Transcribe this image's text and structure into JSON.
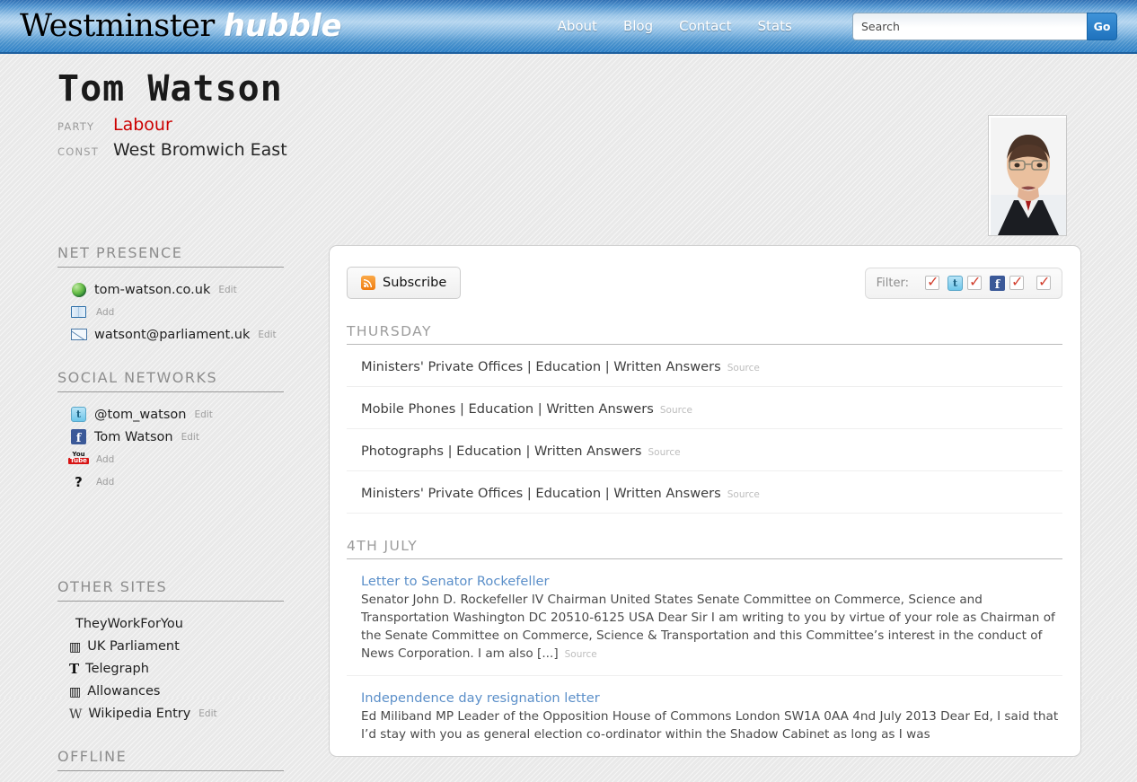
{
  "header": {
    "logo_primary": "Westminster",
    "logo_secondary": "hubble",
    "nav": [
      {
        "label": "About"
      },
      {
        "label": "Blog"
      },
      {
        "label": "Contact"
      },
      {
        "label": "Stats"
      }
    ],
    "search": {
      "placeholder": "Search",
      "value": "",
      "button_label": "Go"
    },
    "colors": {
      "accent": "#2f82c8",
      "light": "#b4d5ef"
    }
  },
  "person": {
    "name": "Tom Watson",
    "party_label": "PARTY",
    "party_value": "Labour",
    "party_color": "#cc0000",
    "const_label": "CONST",
    "const_value": "West Bromwich East",
    "photo_alt": "Tom Watson portrait"
  },
  "sidebar": {
    "sections": [
      {
        "title": "NET PRESENCE",
        "items": [
          {
            "icon": "globe-icon",
            "label": "tom-watson.co.uk",
            "action": "Edit"
          },
          {
            "icon": "book-icon",
            "label": "",
            "action": "Add"
          },
          {
            "icon": "mail-icon",
            "label": "watsont@parliament.uk",
            "action": "Edit"
          }
        ]
      },
      {
        "title": "SOCIAL NETWORKS",
        "items": [
          {
            "icon": "twitter-icon",
            "label": "@tom_watson",
            "action": "Edit"
          },
          {
            "icon": "facebook-icon",
            "label": "Tom Watson",
            "action": "Edit"
          },
          {
            "icon": "youtube-icon",
            "label": "",
            "action": "Add"
          },
          {
            "icon": "unknown-icon",
            "label": "",
            "action": "Add"
          }
        ]
      },
      {
        "title": "OTHER SITES",
        "items": [
          {
            "icon": "theyworkforyou-icon",
            "label": "TheyWorkForYou",
            "action": ""
          },
          {
            "icon": "portcullis-icon",
            "label": "UK Parliament",
            "action": ""
          },
          {
            "icon": "telegraph-icon",
            "label": "Telegraph",
            "action": ""
          },
          {
            "icon": "portcullis-icon",
            "label": "Allowances",
            "action": ""
          },
          {
            "icon": "wikipedia-icon",
            "label": "Wikipedia Entry",
            "action": "Edit"
          }
        ]
      },
      {
        "title": "OFFLINE",
        "items": []
      }
    ]
  },
  "main": {
    "subscribe_label": "Subscribe",
    "filter_label": "Filter:",
    "filters": [
      {
        "icon": "globe-icon",
        "checked": true
      },
      {
        "icon": "twitter-icon",
        "checked": true
      },
      {
        "icon": "facebook-icon",
        "checked": true
      },
      {
        "icon": "theyworkforyou-icon",
        "checked": true
      }
    ],
    "source_label": "Source",
    "groups": [
      {
        "date": "THURSDAY",
        "entries": [
          {
            "icon": "theyworkforyou-icon",
            "title": "Ministers' Private Offices | Education | Written Answers",
            "link": false,
            "desc": ""
          },
          {
            "icon": "theyworkforyou-icon",
            "title": "Mobile Phones | Education | Written Answers",
            "link": false,
            "desc": ""
          },
          {
            "icon": "theyworkforyou-icon",
            "title": "Photographs | Education | Written Answers",
            "link": false,
            "desc": ""
          },
          {
            "icon": "theyworkforyou-icon",
            "title": "Ministers' Private Offices | Education | Written Answers",
            "link": false,
            "desc": ""
          }
        ]
      },
      {
        "date": "4TH JULY",
        "entries": [
          {
            "icon": "globe-icon",
            "title": "Letter to Senator Rockefeller",
            "link": true,
            "desc": "Senator John D. Rockefeller IV Chairman United States Senate Committee on Commerce, Science and Transportation Washington DC 20510-6125 USA Dear Sir I am writing to you by virtue of your role as Chairman of the Senate Committee on Commerce, Science & Transportation and this Committee’s interest in the conduct of News Corporation.  I am also [...]"
          },
          {
            "icon": "globe-icon",
            "title": "Independence day resignation letter",
            "link": true,
            "desc": "Ed Miliband MP Leader of the Opposition House of Commons London SW1A 0AA   4nd July 2013 Dear Ed, I said that I’d stay with you as general election co-ordinator within the Shadow Cabinet as long as I was"
          }
        ]
      }
    ]
  }
}
